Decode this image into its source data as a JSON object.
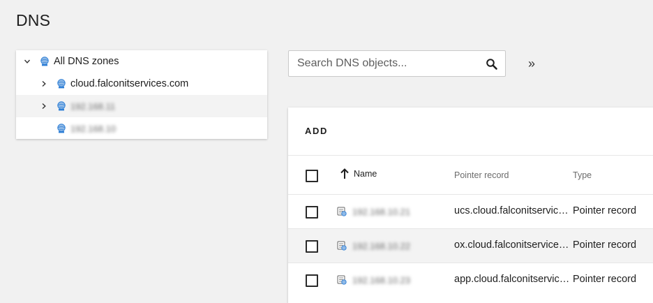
{
  "page": {
    "title": "DNS"
  },
  "tree": {
    "items": [
      {
        "label": "All DNS zones",
        "expanded": true,
        "icon": "dns-zone-icon"
      },
      {
        "label": "cloud.falconitservices.com",
        "expanded": false,
        "icon": "dns-zone-icon"
      },
      {
        "label": "192.168.11",
        "expanded": false,
        "icon": "dns-zone-icon"
      },
      {
        "label": "192.168.10",
        "icon": "dns-zone-icon"
      }
    ]
  },
  "search": {
    "value": "",
    "placeholder": "Search DNS objects..."
  },
  "toolbar": {
    "expand_label": "»",
    "add_label": "ADD"
  },
  "grid": {
    "columns": {
      "name": "Name",
      "pointer": "Pointer record",
      "type": "Type"
    },
    "rows": [
      {
        "name": "192.168.10.21",
        "pointer": "ucs.cloud.falconitservices.com",
        "type": "Pointer record"
      },
      {
        "name": "192.168.10.22",
        "pointer": "ox.cloud.falconitservices.com",
        "type": "Pointer record"
      },
      {
        "name": "192.168.10.23",
        "pointer": "app.cloud.falconitservices.com",
        "type": "Pointer record"
      }
    ]
  },
  "colors": {
    "background": "#f1f1f1",
    "panel": "#ffffff",
    "alt_row": "#f3f3f3",
    "icon_blue": "#2f7fd6",
    "icon_globe": "#8fb9e6"
  }
}
